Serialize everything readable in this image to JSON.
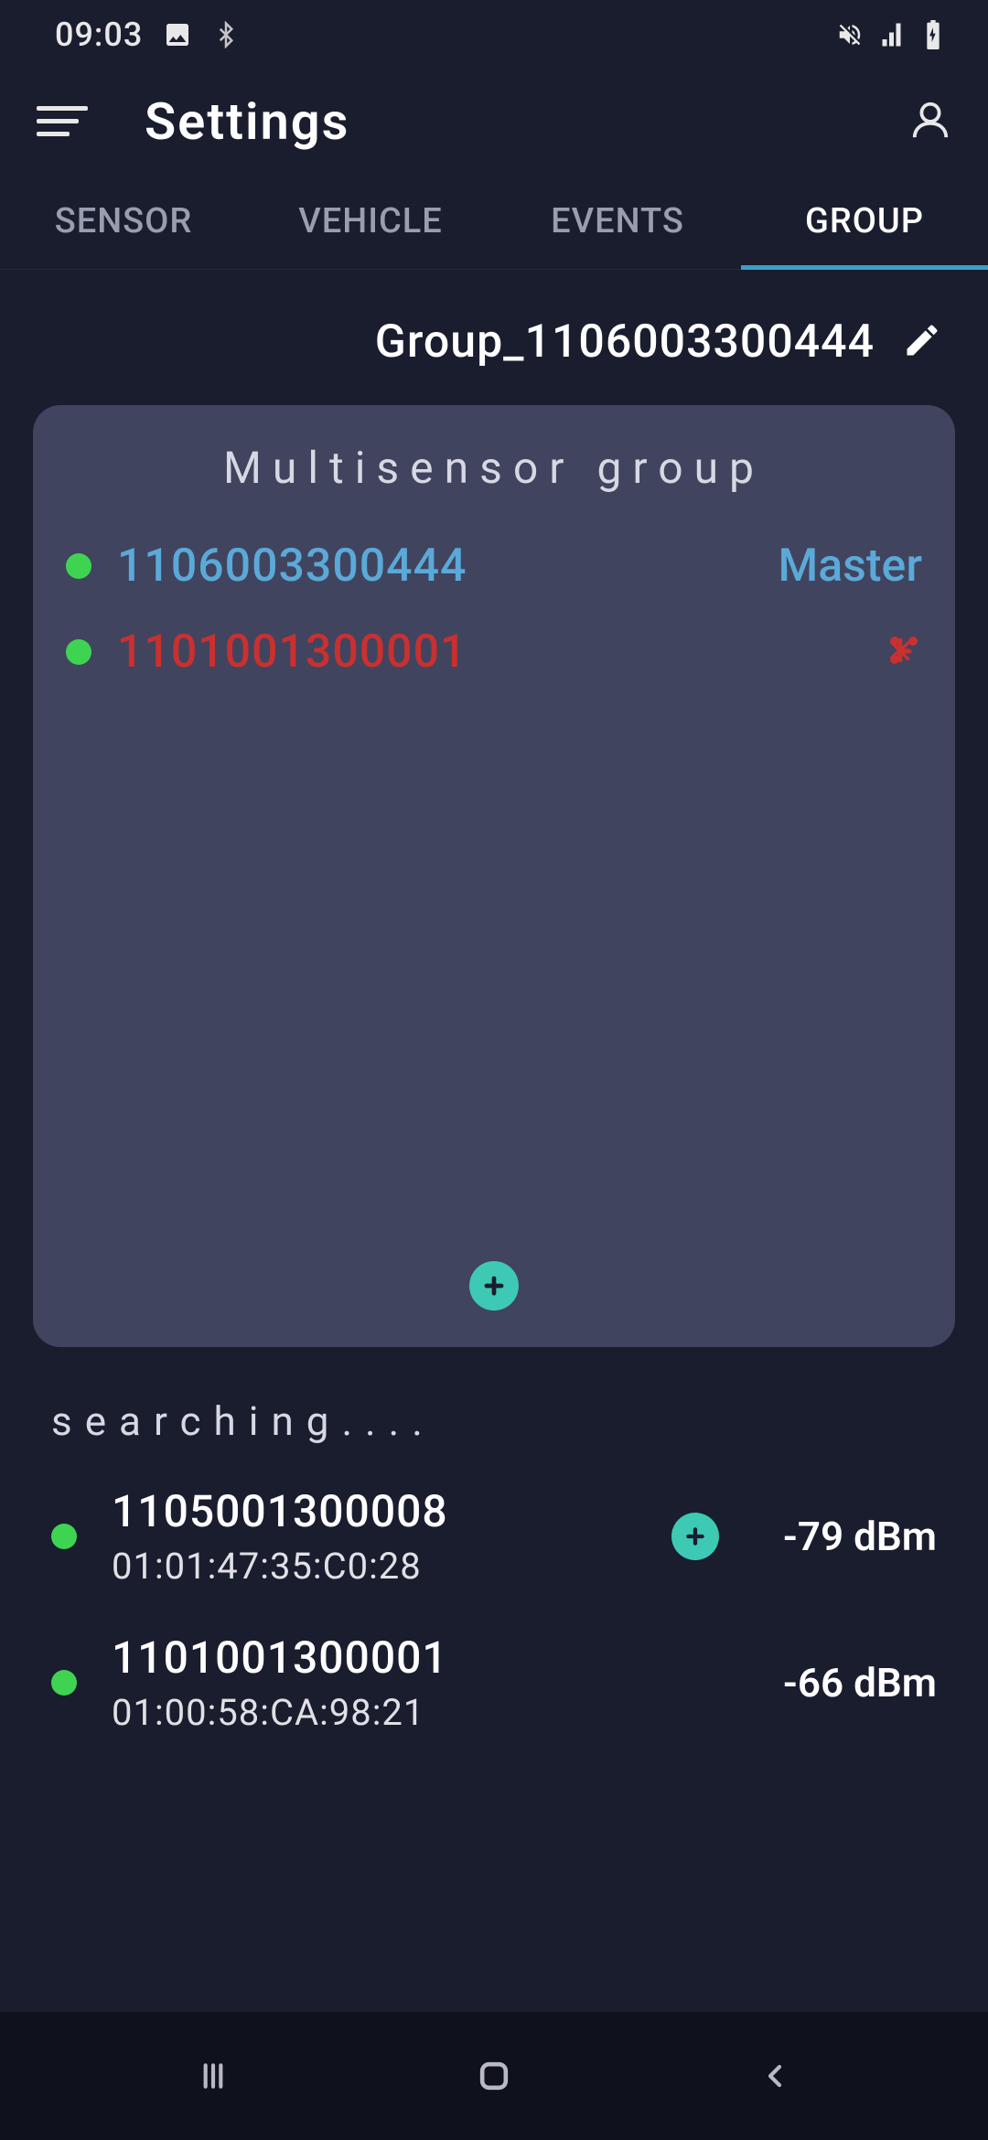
{
  "status_bar": {
    "time": "09:03"
  },
  "header": {
    "title": "Settings"
  },
  "tabs": [
    {
      "label": "SENSOR",
      "active": false
    },
    {
      "label": "VEHICLE",
      "active": false
    },
    {
      "label": "EVENTS",
      "active": false
    },
    {
      "label": "GROUP",
      "active": true
    }
  ],
  "group": {
    "name": "Group_1106003300444",
    "card_title": "Multisensor group",
    "members": [
      {
        "id": "1106003300444",
        "role": "Master",
        "online": true,
        "is_master": true
      },
      {
        "id": "1101001300001",
        "role": "",
        "online": true,
        "is_master": false
      }
    ]
  },
  "search": {
    "label": "searching....",
    "results": [
      {
        "id": "1105001300008",
        "mac": "01:01:47:35:C0:28",
        "rssi": "-79 dBm",
        "can_add": true,
        "online": true
      },
      {
        "id": "1101001300001",
        "mac": "01:00:58:CA:98:21",
        "rssi": "-66 dBm",
        "can_add": false,
        "online": true
      }
    ]
  },
  "colors": {
    "accent": "#3dc9b3",
    "link": "#5aa9d9",
    "danger": "#c93030",
    "online": "#3ed452"
  }
}
